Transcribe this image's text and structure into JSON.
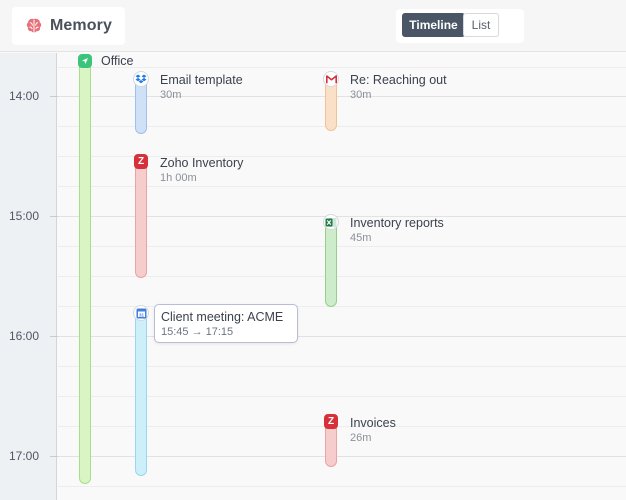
{
  "app": {
    "name": "Memory",
    "logo_icon": "brain-icon",
    "accent": "#e8707a"
  },
  "view_toggle": {
    "options": [
      "Timeline",
      "List"
    ],
    "selected": "Timeline",
    "selected_color": "#4a5566"
  },
  "timeline": {
    "hours": [
      "14:00",
      "15:00",
      "16:00",
      "17:00"
    ],
    "events": [
      {
        "id": "office",
        "title": "Office",
        "duration": "",
        "icon": "location-arrow-icon",
        "color": "#d9f5c4",
        "border": "#a8de88"
      },
      {
        "id": "email",
        "title": "Email template",
        "duration": "30m",
        "icon": "dropbox-icon",
        "color": "#cfe1f7",
        "border": "#9fc0ea"
      },
      {
        "id": "zoho1",
        "title": "Zoho Inventory",
        "duration": "1h 00m",
        "icon": "zoho-icon",
        "color": "#f7cccc",
        "border": "#e8a3a3"
      },
      {
        "id": "meeting",
        "title": "Client meeting: ACME",
        "duration": "15:45 → 17:15",
        "icon": "calendar-icon",
        "color": "#cdeffa",
        "border": "#9ad6ec"
      },
      {
        "id": "reply",
        "title": "Re: Reaching out",
        "duration": "30m",
        "icon": "gmail-icon",
        "color": "#fae0c6",
        "border": "#f0c397"
      },
      {
        "id": "reports",
        "title": "Inventory reports",
        "duration": "45m",
        "icon": "excel-icon",
        "color": "#cdecc9",
        "border": "#94d08c"
      },
      {
        "id": "invoices",
        "title": "Invoices",
        "duration": "26m",
        "icon": "zoho-icon",
        "color": "#f7cccc",
        "border": "#e8a3a3"
      }
    ]
  }
}
